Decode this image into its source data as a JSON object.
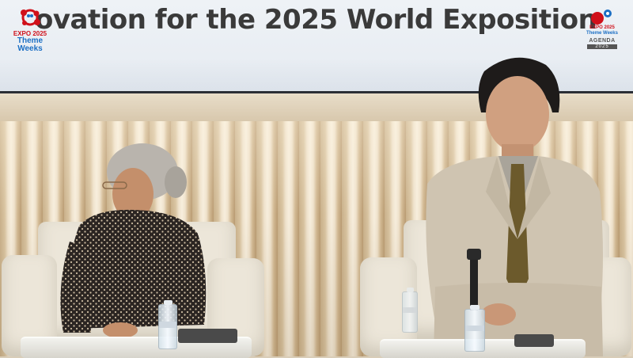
{
  "screen": {
    "title": "ovation for the 2025 World Exposition"
  },
  "logo_left": {
    "line1": "EXPO 2025",
    "line2": "Theme",
    "line3": "Weeks"
  },
  "logo_right": {
    "line1": "EXPO 2025",
    "line2": "Theme Weeks",
    "line3": "AGENDA",
    "line4": "2025"
  },
  "colors": {
    "expo_red": "#d0101a",
    "expo_blue": "#1c6fc4",
    "title_text": "#3a3a3a",
    "wall_slats": "#d8c3a0",
    "chair": "#ece6d9"
  }
}
